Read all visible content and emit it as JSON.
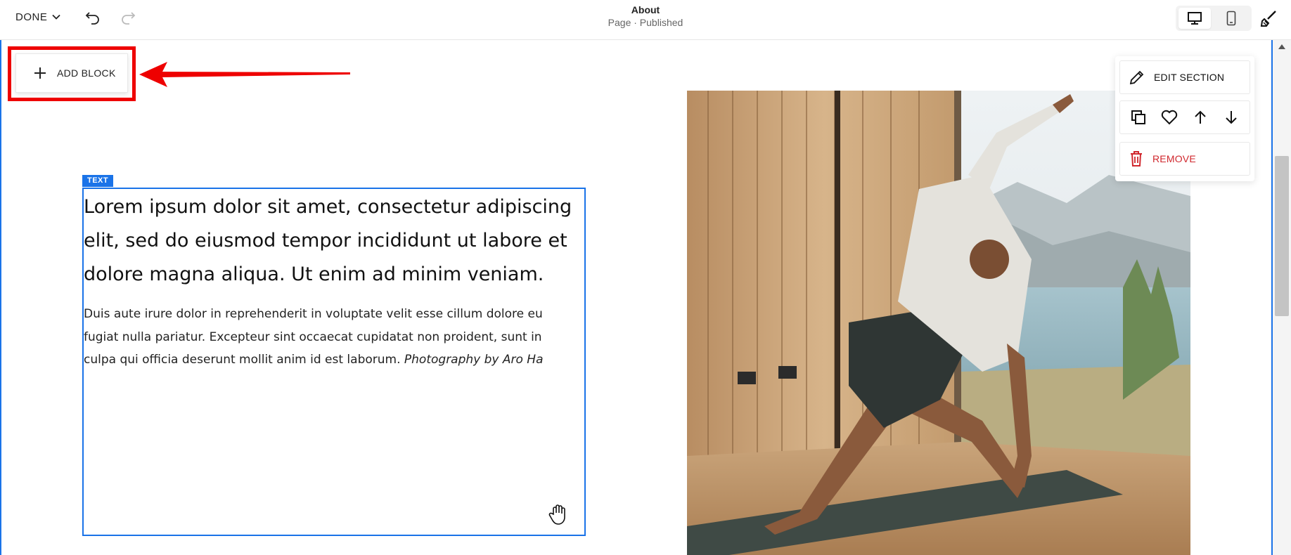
{
  "toolbar": {
    "done_label": "DONE",
    "page_title": "About",
    "page_status": "Page · Published"
  },
  "add_block": {
    "label": "ADD BLOCK"
  },
  "text_block": {
    "tag": "TEXT",
    "lead": "Lorem ipsum dolor sit amet, consectetur adipiscing elit, sed do eiusmod tempor incididunt ut labore et dolore magna aliqua. Ut enim ad minim veniam.",
    "body": "Duis aute irure dolor in reprehenderit in voluptate velit esse cillum dolore eu fugiat nulla pariatur. Excepteur sint occaecat cupidatat non proident, sunt in culpa qui officia deserunt mollit anim id est laborum.",
    "credit": "Photography by Aro Ha"
  },
  "section_menu": {
    "edit_label": "EDIT SECTION",
    "remove_label": "REMOVE"
  },
  "colors": {
    "selection": "#1a73e8",
    "highlight": "#e00000",
    "remove": "#d0272d"
  },
  "icons": {
    "done": "chevron-down-icon",
    "undo": "undo-icon",
    "redo": "redo-icon",
    "desktop": "desktop-icon",
    "mobile": "mobile-icon",
    "design": "paintbrush-icon",
    "add": "plus-icon",
    "edit": "pencil-icon",
    "duplicate": "duplicate-icon",
    "save": "heart-icon",
    "move_up": "arrow-up-icon",
    "move_down": "arrow-down-icon",
    "remove": "trash-icon"
  }
}
